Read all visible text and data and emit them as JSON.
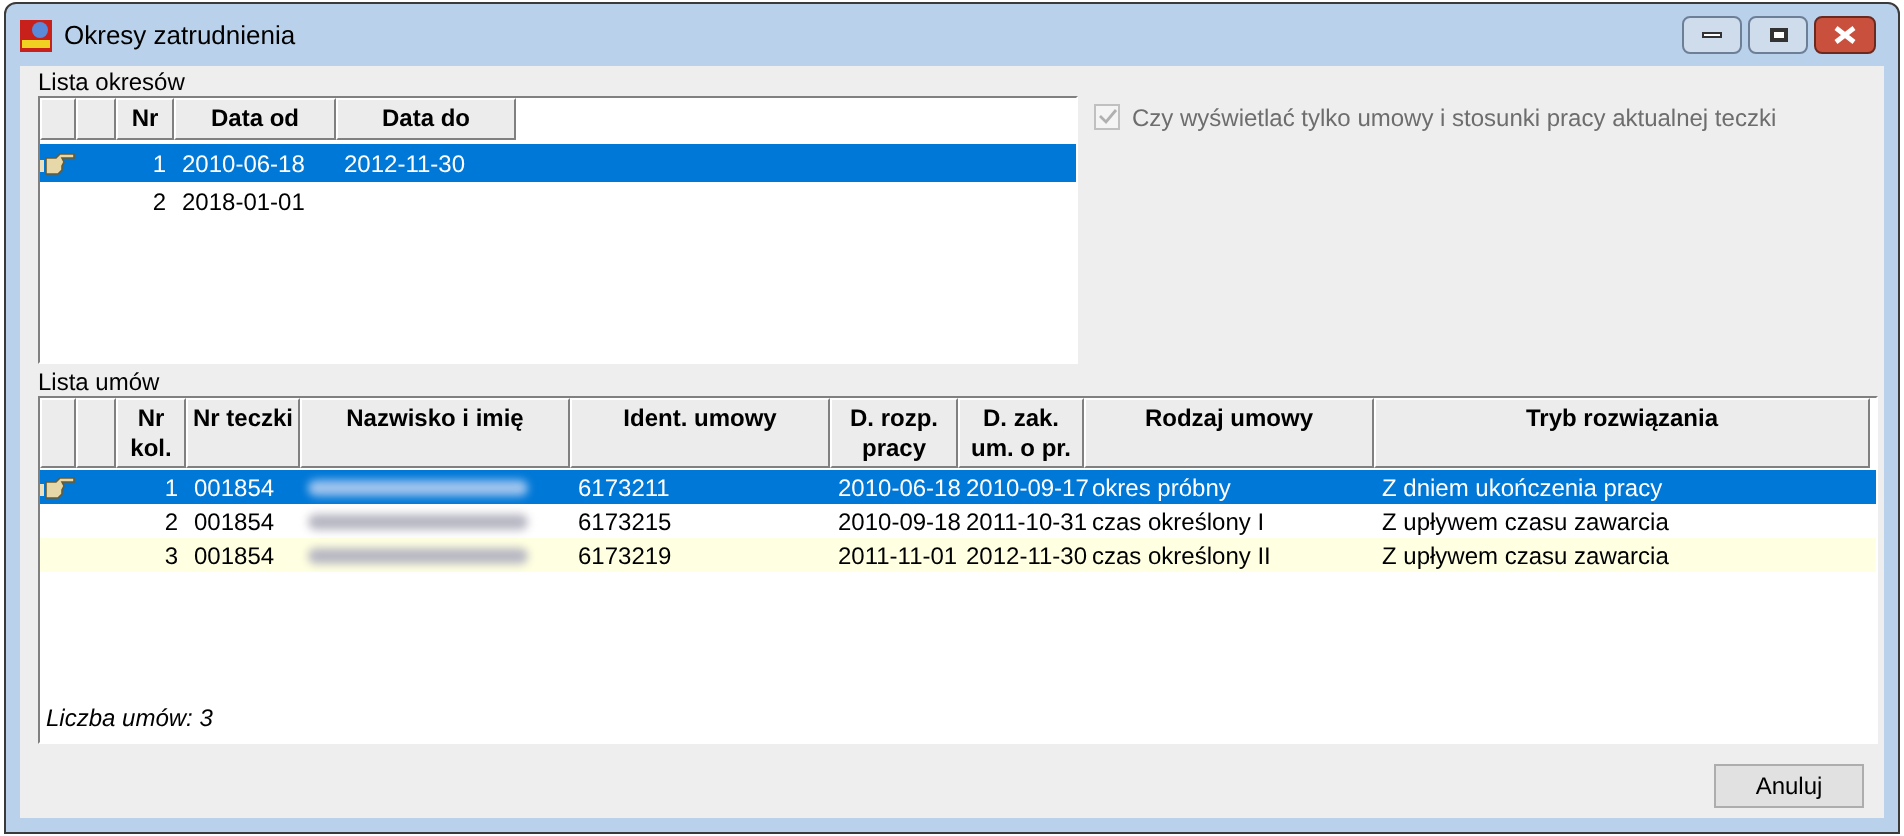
{
  "window": {
    "title": "Okresy zatrudnienia"
  },
  "periods": {
    "label": "Lista okresów",
    "columns": [
      "Nr",
      "Data od",
      "Data do"
    ],
    "rows": [
      {
        "selected": true,
        "cells": [
          "1",
          "2010-06-18",
          "2012-11-30"
        ]
      },
      {
        "selected": false,
        "cells": [
          "2",
          "2018-01-01",
          ""
        ]
      }
    ]
  },
  "filter": {
    "label": "Czy wyświetlać tylko umowy i stosunki pracy aktualnej teczki",
    "checked": true,
    "disabled": true
  },
  "contracts": {
    "label": "Lista umów",
    "columns": [
      "Nr kol.",
      "Nr teczki",
      "Nazwisko i imię",
      "Ident. umowy",
      "D. rozp. pracy",
      "D. zak. um. o pr.",
      "Rodzaj umowy",
      "Tryb rozwiązania"
    ],
    "rows": [
      {
        "selected": true,
        "highlighted": false,
        "cells": [
          "1",
          "001854",
          "",
          "6173211",
          "2010-06-18",
          "2010-09-17",
          "okres próbny",
          "Z dniem ukończenia pracy"
        ]
      },
      {
        "selected": false,
        "highlighted": false,
        "cells": [
          "2",
          "001854",
          "",
          "6173215",
          "2010-09-18",
          "2011-10-31",
          "czas określony I",
          "Z upływem czasu zawarcia"
        ]
      },
      {
        "selected": false,
        "highlighted": true,
        "cells": [
          "3",
          "001854",
          "",
          "6173219",
          "2011-11-01",
          "2012-11-30",
          "czas określony II",
          "Z upływem czasu zawarcia"
        ]
      }
    ],
    "footer": "Liczba umów: 3"
  },
  "buttons": [
    "Anuluj"
  ]
}
